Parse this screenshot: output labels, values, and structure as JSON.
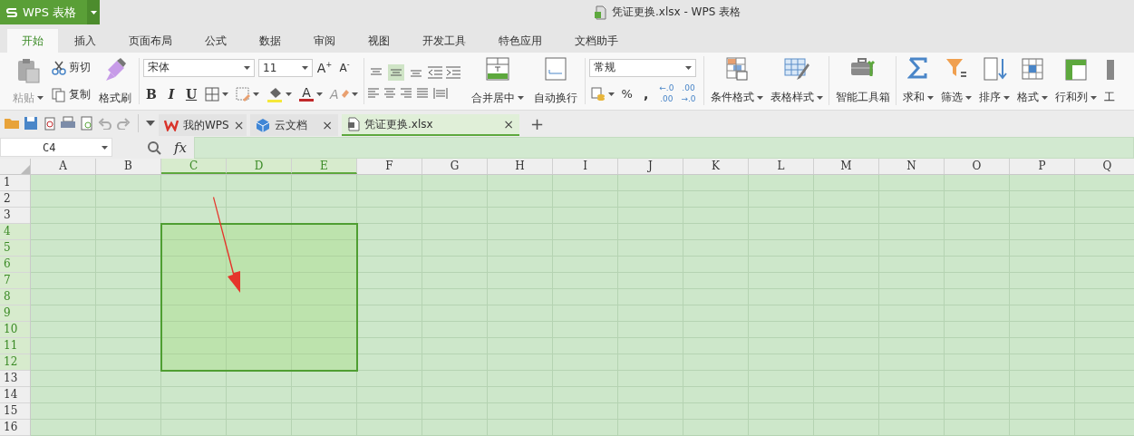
{
  "app_button": {
    "label": "WPS 表格"
  },
  "window": {
    "title": "凭证更换.xlsx - WPS 表格"
  },
  "menu_tabs": [
    {
      "label": "开始",
      "selected": true
    },
    {
      "label": "插入",
      "selected": false
    },
    {
      "label": "页面布局",
      "selected": false
    },
    {
      "label": "公式",
      "selected": false
    },
    {
      "label": "数据",
      "selected": false
    },
    {
      "label": "审阅",
      "selected": false
    },
    {
      "label": "视图",
      "selected": false
    },
    {
      "label": "开发工具",
      "selected": false
    },
    {
      "label": "特色应用",
      "selected": false
    },
    {
      "label": "文档助手",
      "selected": false
    }
  ],
  "ribbon": {
    "clipboard": {
      "paste": "粘贴",
      "cut": "剪切",
      "copy": "复制",
      "format_painter": "格式刷"
    },
    "font": {
      "family": "宋体",
      "size": "11",
      "grow": "A$^{+}$",
      "shrink": "A$^{-}$",
      "bold": "B",
      "italic": "I",
      "underline": "U",
      "font_color": "A",
      "clear_format": "A"
    },
    "vertical_align": [
      {
        "selected": false
      },
      {
        "selected": true
      },
      {
        "selected": false
      }
    ],
    "merge": "合并居中",
    "wrap": "自动换行",
    "number": {
      "format": "常规",
      "percent": "%",
      "comma": ",",
      "add_decimal": [
        "←.0",
        ".00"
      ],
      "remove_decimal": [
        ".00",
        "→.0"
      ]
    },
    "tools": [
      {
        "kind": "conditional",
        "label": "条件格式",
        "dropdown": true,
        "separator_before": true
      },
      {
        "kind": "table_style",
        "label": "表格样式",
        "dropdown": true,
        "separator_before": false
      },
      {
        "kind": "toolbox",
        "label": "智能工具箱",
        "dropdown": false,
        "separator_before": true
      },
      {
        "kind": "sum",
        "label": "求和",
        "dropdown": true,
        "separator_before": true
      },
      {
        "kind": "filter",
        "label": "筛选",
        "dropdown": true,
        "separator_before": false
      },
      {
        "kind": "sort",
        "label": "排序",
        "dropdown": true,
        "separator_before": false
      },
      {
        "kind": "format",
        "label": "格式",
        "dropdown": true,
        "separator_before": false
      },
      {
        "kind": "rows_cols",
        "label": "行和列",
        "dropdown": true,
        "separator_before": false
      },
      {
        "kind": "partial",
        "label": "工",
        "dropdown": false,
        "separator_before": false
      }
    ]
  },
  "doc_tabs": [
    {
      "kind": "wps",
      "label": "我的WPS",
      "selected": false,
      "close": "×"
    },
    {
      "kind": "cloud",
      "label": "云文档",
      "selected": false,
      "close": "×"
    },
    {
      "kind": "sheet",
      "label": "凭证更换.xlsx",
      "selected": true,
      "close": "×"
    }
  ],
  "new_tab": "+",
  "formula_bar": {
    "name_box": "C4",
    "fx": "fx"
  },
  "columns": [
    {
      "label": "A",
      "selected": false
    },
    {
      "label": "B",
      "selected": false
    },
    {
      "label": "C",
      "selected": true
    },
    {
      "label": "D",
      "selected": true
    },
    {
      "label": "E",
      "selected": true
    },
    {
      "label": "F",
      "selected": false
    },
    {
      "label": "G",
      "selected": false
    },
    {
      "label": "H",
      "selected": false
    },
    {
      "label": "I",
      "selected": false
    },
    {
      "label": "J",
      "selected": false
    },
    {
      "label": "K",
      "selected": false
    },
    {
      "label": "L",
      "selected": false
    },
    {
      "label": "M",
      "selected": false
    },
    {
      "label": "N",
      "selected": false
    },
    {
      "label": "O",
      "selected": false
    },
    {
      "label": "P",
      "selected": false
    },
    {
      "label": "Q",
      "selected": false
    }
  ],
  "rows": [
    {
      "label": "1",
      "selected": false
    },
    {
      "label": "2",
      "selected": false
    },
    {
      "label": "3",
      "selected": false
    },
    {
      "label": "4",
      "selected": true
    },
    {
      "label": "5",
      "selected": true
    },
    {
      "label": "6",
      "selected": true
    },
    {
      "label": "7",
      "selected": true
    },
    {
      "label": "8",
      "selected": true
    },
    {
      "label": "9",
      "selected": true
    },
    {
      "label": "10",
      "selected": true
    },
    {
      "label": "11",
      "selected": true
    },
    {
      "label": "12",
      "selected": true
    },
    {
      "label": "13",
      "selected": false
    },
    {
      "label": "14",
      "selected": false
    },
    {
      "label": "15",
      "selected": false
    },
    {
      "label": "16",
      "selected": false
    }
  ]
}
